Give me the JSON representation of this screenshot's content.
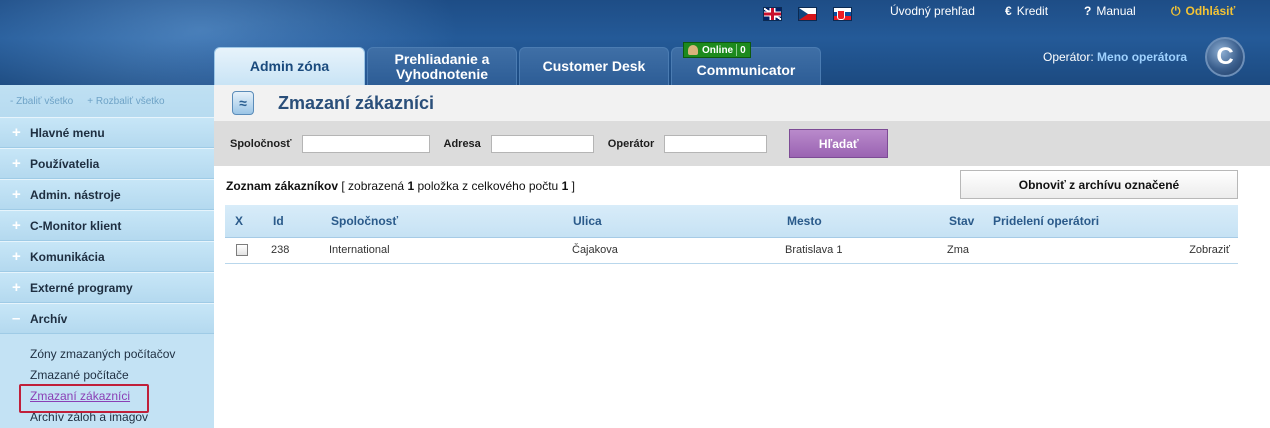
{
  "header": {
    "flags": [
      "uk-flag-icon",
      "cz-flag-icon",
      "sk-flag-icon"
    ],
    "links": {
      "overview": "Úvodný prehľad",
      "credit": "Kredit",
      "manual": "Manual",
      "logout": "Odhlásiť"
    },
    "tabs": {
      "admin": "Admin zóna",
      "prehl_line1": "Prehliadanie a",
      "prehl_line2": "Vyhodnotenie",
      "desk": "Customer Desk",
      "comm": "Communicator"
    },
    "online": {
      "label": "Online",
      "count": "0"
    },
    "operator": {
      "label": "Operátor:",
      "name": "Meno operátora"
    },
    "logo_letter": "C"
  },
  "sidebar": {
    "collapse_all": "Zbaliť všetko",
    "expand_all": "Rozbaliť všetko",
    "items": [
      {
        "sign": "+",
        "label": "Hlavné menu"
      },
      {
        "sign": "+",
        "label": "Používatelia"
      },
      {
        "sign": "+",
        "label": "Admin. nástroje"
      },
      {
        "sign": "+",
        "label": "C-Monitor klient"
      },
      {
        "sign": "+",
        "label": "Komunikácia"
      },
      {
        "sign": "+",
        "label": "Externé programy"
      },
      {
        "sign": "–",
        "label": "Archív"
      }
    ],
    "submenu": [
      "Zóny zmazaných počítačov",
      "Zmazané počítače",
      "Zmazaní zákazníci",
      "Archív záloh a imagov"
    ]
  },
  "main": {
    "title": "Zmazaní zákazníci",
    "search": {
      "company_label": "Spoločnosť",
      "address_label": "Adresa",
      "operator_label": "Operátor",
      "company_value": "",
      "address_value": "",
      "operator_value": "",
      "button": "Hľadať"
    },
    "list": {
      "title": "Zoznam zákazníkov",
      "text1": "[ zobrazená",
      "shown": "1",
      "text2": "položka z celkového počtu",
      "total": "1",
      "text3": "]"
    },
    "restore_button": "Obnoviť z archívu označené",
    "columns": [
      "X",
      "Id",
      "Spoločnosť",
      "Ulica",
      "Mesto",
      "Stav",
      "Pridelení operátori",
      ""
    ],
    "rows": [
      {
        "id": "238",
        "company": "International",
        "street": "Čajakova",
        "city": "Bratislava 1",
        "status": "Zma",
        "operators": "",
        "action": "Zobraziť"
      }
    ]
  }
}
